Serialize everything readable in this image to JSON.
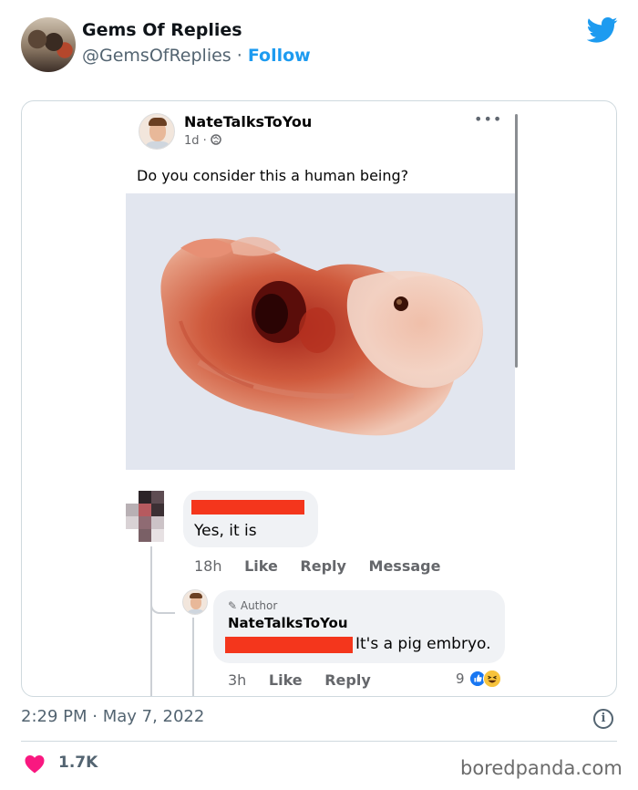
{
  "tweet": {
    "display_name": "Gems Of Replies",
    "handle": "@GemsOfReplies",
    "separator": " · ",
    "follow_label": "Follow",
    "timestamp": "2:29 PM · May 7, 2022",
    "like_count": "1.7K"
  },
  "embedded_post": {
    "author": "NateTalksToYou",
    "time": "1d ·",
    "menu_icon": "•••",
    "caption": "Do you consider this a human being?",
    "comment1": {
      "text": "Yes, it is",
      "time": "18h",
      "like_label": "Like",
      "reply_label": "Reply",
      "message_label": "Message"
    },
    "comment2": {
      "author_tag": "✎ Author",
      "author": "NateTalksToYou",
      "text": "It's a pig embryo.",
      "time": "3h",
      "like_label": "Like",
      "reply_label": "Reply",
      "reaction_count": "9"
    }
  },
  "watermark": "boredpanda.com",
  "icons": {
    "twitter": "twitter-bird-icon",
    "info": "info-icon",
    "heart": "heart-icon",
    "globe": "globe-icon"
  },
  "colors": {
    "twitter_blue": "#1d9bf0",
    "heart_pink": "#f91880",
    "redaction_red": "#f4361c",
    "fb_like_blue": "#1877f2"
  }
}
